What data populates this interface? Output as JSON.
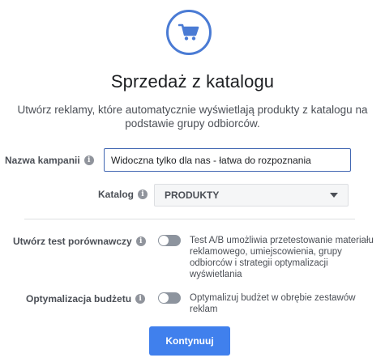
{
  "header": {
    "icon": "shopping-cart-icon",
    "title": "Sprzedaż z katalogu",
    "subtitle": "Utwórz reklamy, które automatycznie wyświetlają produkty z katalogu na podstawie grupy odbiorców."
  },
  "campaign": {
    "label": "Nazwa kampanii",
    "value": "Widoczna tylko dla nas - łatwa do rozpoznania"
  },
  "catalog": {
    "label": "Katalog",
    "selected": "PRODUKTY"
  },
  "ab_test": {
    "label": "Utwórz test porównawczy",
    "enabled": false,
    "description": "Test A/B umożliwia przetestowanie materiału reklamowego, umiejscowienia, grupy odbiorców i strategii optymalizacji wyświetlania"
  },
  "budget_optimization": {
    "label": "Optymalizacja budżetu",
    "enabled": false,
    "description": "Optymalizuj budżet w obrębie zestawów reklam"
  },
  "actions": {
    "continue_label": "Kontynuuj"
  },
  "colors": {
    "accent": "#4080ed",
    "icon_ring": "#4a7bd4",
    "toggle_off": "#8d949e"
  }
}
